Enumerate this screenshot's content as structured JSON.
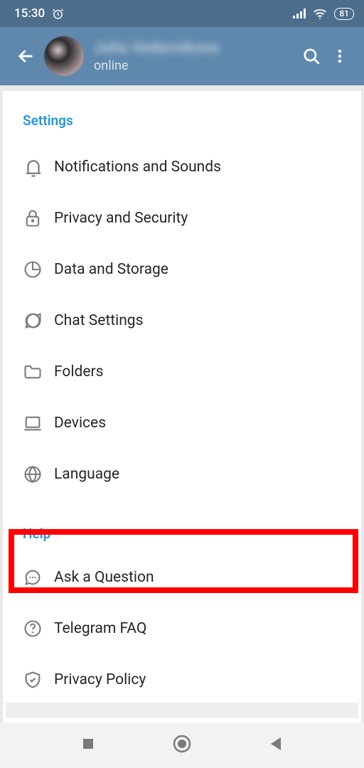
{
  "status_bar": {
    "time": "15:30",
    "battery": "81"
  },
  "header": {
    "name": "Julia Vedernikova",
    "status": "online"
  },
  "sections": {
    "settings_title": "Settings",
    "help_title": "Help"
  },
  "settings": {
    "notifications": "Notifications and Sounds",
    "privacy": "Privacy and Security",
    "data": "Data and Storage",
    "chat": "Chat Settings",
    "folders": "Folders",
    "devices": "Devices",
    "language": "Language"
  },
  "help": {
    "ask": "Ask a Question",
    "faq": "Telegram FAQ",
    "policy": "Privacy Policy"
  }
}
